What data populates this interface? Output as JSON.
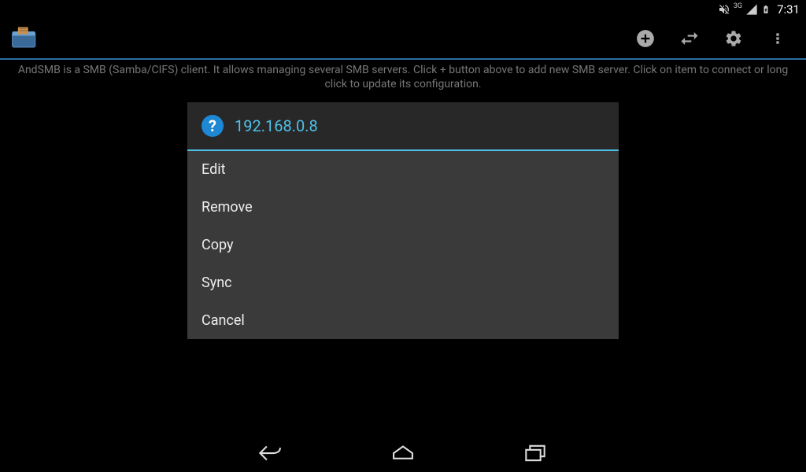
{
  "status_bar": {
    "network_label": "3G",
    "time": "7:31"
  },
  "description": "AndSMB is a SMB (Samba/CIFS) client. It allows managing several SMB servers. Click + button above to add new SMB server. Click on item to connect or long click to update its configuration.",
  "dialog": {
    "title": "192.168.0.8",
    "items": [
      {
        "label": "Edit"
      },
      {
        "label": "Remove"
      },
      {
        "label": "Copy"
      },
      {
        "label": "Sync"
      },
      {
        "label": "Cancel"
      }
    ]
  }
}
